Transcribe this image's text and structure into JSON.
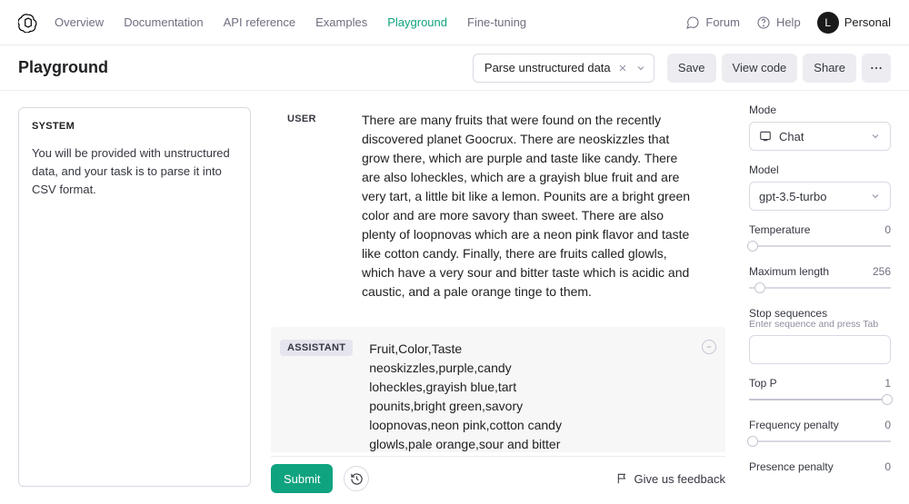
{
  "nav": {
    "links": [
      "Overview",
      "Documentation",
      "API reference",
      "Examples",
      "Playground",
      "Fine-tuning"
    ],
    "active_index": 4,
    "forum": "Forum",
    "help": "Help",
    "account_initial": "L",
    "account_label": "Personal"
  },
  "titlebar": {
    "page_title": "Playground",
    "preset": "Parse unstructured data",
    "save": "Save",
    "view_code": "View code",
    "share": "Share"
  },
  "system": {
    "label": "SYSTEM",
    "text": "You will be provided with unstructured data, and your task is to parse it into CSV format."
  },
  "conversation": {
    "user_label": "USER",
    "assistant_label": "ASSISTANT",
    "user_message": "There are many fruits that were found on the recently discovered planet Goocrux. There are neoskizzles that grow there, which are purple and taste like candy. There are also loheckles, which are a grayish blue fruit and are very tart, a little bit like a lemon. Pounits are a bright green color and are more savory than sweet. There are also plenty of loopnovas which are a neon pink flavor and taste like cotton candy. Finally, there are fruits called glowls, which have a very sour and bitter taste which is acidic and caustic, and a pale orange tinge to them.",
    "assistant_message": "Fruit,Color,Taste\nneoskizzles,purple,candy\nloheckles,grayish blue,tart\npounits,bright green,savory\nloopnovas,neon pink,cotton candy\nglowls,pale orange,sour and bitter",
    "submit": "Submit",
    "feedback": "Give us feedback"
  },
  "params": {
    "mode_label": "Mode",
    "mode_value": "Chat",
    "model_label": "Model",
    "model_value": "gpt-3.5-turbo",
    "temperature_label": "Temperature",
    "temperature_value": "0",
    "maxlen_label": "Maximum length",
    "maxlen_value": "256",
    "stop_label": "Stop sequences",
    "stop_hint": "Enter sequence and press Tab",
    "topp_label": "Top P",
    "topp_value": "1",
    "freq_label": "Frequency penalty",
    "freq_value": "0",
    "pres_label": "Presence penalty",
    "pres_value": "0"
  }
}
